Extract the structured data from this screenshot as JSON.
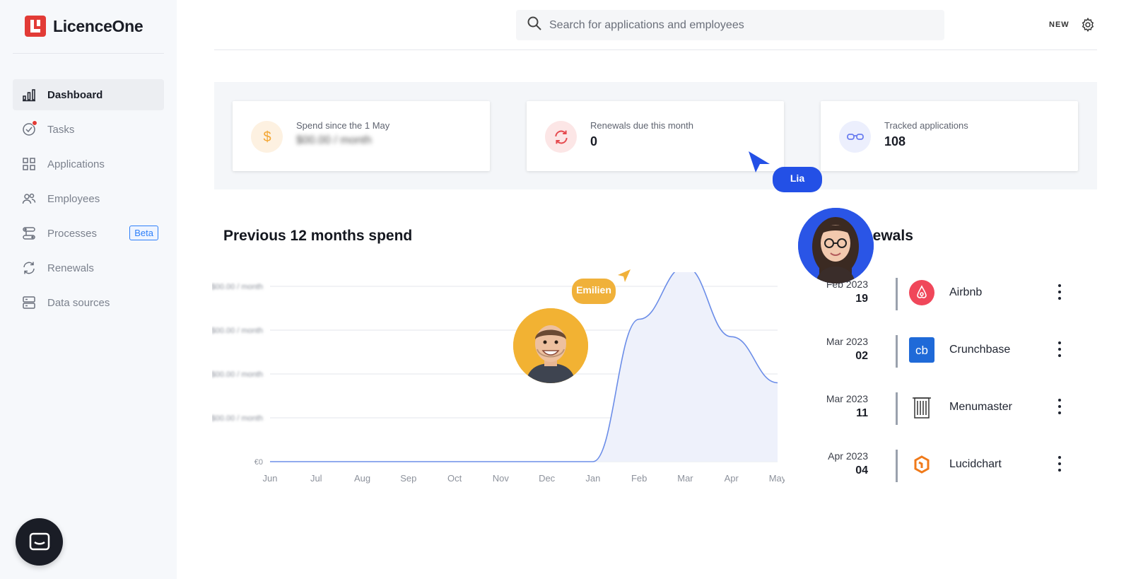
{
  "app": {
    "name": "LicenceOne"
  },
  "sidebar": {
    "items": [
      {
        "label": "Dashboard",
        "icon": "bar-chart-icon",
        "active": true
      },
      {
        "label": "Tasks",
        "icon": "check-circle-icon",
        "active": false
      },
      {
        "label": "Applications",
        "icon": "grid-icon",
        "active": false
      },
      {
        "label": "Employees",
        "icon": "users-icon",
        "active": false
      },
      {
        "label": "Processes",
        "icon": "process-icon",
        "active": false,
        "badge": "Beta"
      },
      {
        "label": "Renewals",
        "icon": "refresh-icon",
        "active": false
      },
      {
        "label": "Data sources",
        "icon": "database-icon",
        "active": false
      }
    ]
  },
  "header": {
    "search_placeholder": "Search for applications and employees",
    "new_label": "NEW"
  },
  "stats": [
    {
      "label": "Spend since the 1 May",
      "value": "$00.00 / month",
      "icon": "dollar-icon",
      "color": "#f3a633",
      "bg": "#fdf1e1"
    },
    {
      "label": "Renewals due this month",
      "value": "0",
      "icon": "refresh-icon",
      "color": "#e5484d",
      "bg": "#fce6e6"
    },
    {
      "label": "Tracked applications",
      "value": "108",
      "icon": "glasses-icon",
      "color": "#6b7ef0",
      "bg": "#eceffd"
    }
  ],
  "collaborators": [
    {
      "name": "Lia",
      "color": "#2350e6"
    },
    {
      "name": "Emilien",
      "color": "#f0b13a"
    }
  ],
  "chart_data": {
    "type": "area",
    "title": "Previous 12 months spend",
    "categories": [
      "Jun",
      "Jul",
      "Aug",
      "Sep",
      "Oct",
      "Nov",
      "Dec",
      "Jan",
      "Feb",
      "Mar",
      "Apr",
      "May"
    ],
    "series": [
      {
        "values": [
          0,
          0,
          0,
          0,
          0,
          0,
          0,
          0,
          3.25,
          4.45,
          2.85,
          1.8
        ]
      }
    ],
    "ytick_labels": [
      "€0",
      "$00.00 / month",
      "$00.00 / month",
      "$00.00 / month",
      "$00.00 / month"
    ],
    "ylim": [
      0,
      4
    ]
  },
  "renewals": {
    "title": "Renewals",
    "items": [
      {
        "month": "Feb 2023",
        "day": "19",
        "app": "Airbnb",
        "logo": "airbnb-logo"
      },
      {
        "month": "Mar 2023",
        "day": "02",
        "app": "Crunchbase",
        "logo": "crunchbase-logo"
      },
      {
        "month": "Mar 2023",
        "day": "11",
        "app": "Menumaster",
        "logo": "menumaster-logo"
      },
      {
        "month": "Apr 2023",
        "day": "04",
        "app": "Lucidchart",
        "logo": "lucidchart-logo"
      }
    ]
  }
}
